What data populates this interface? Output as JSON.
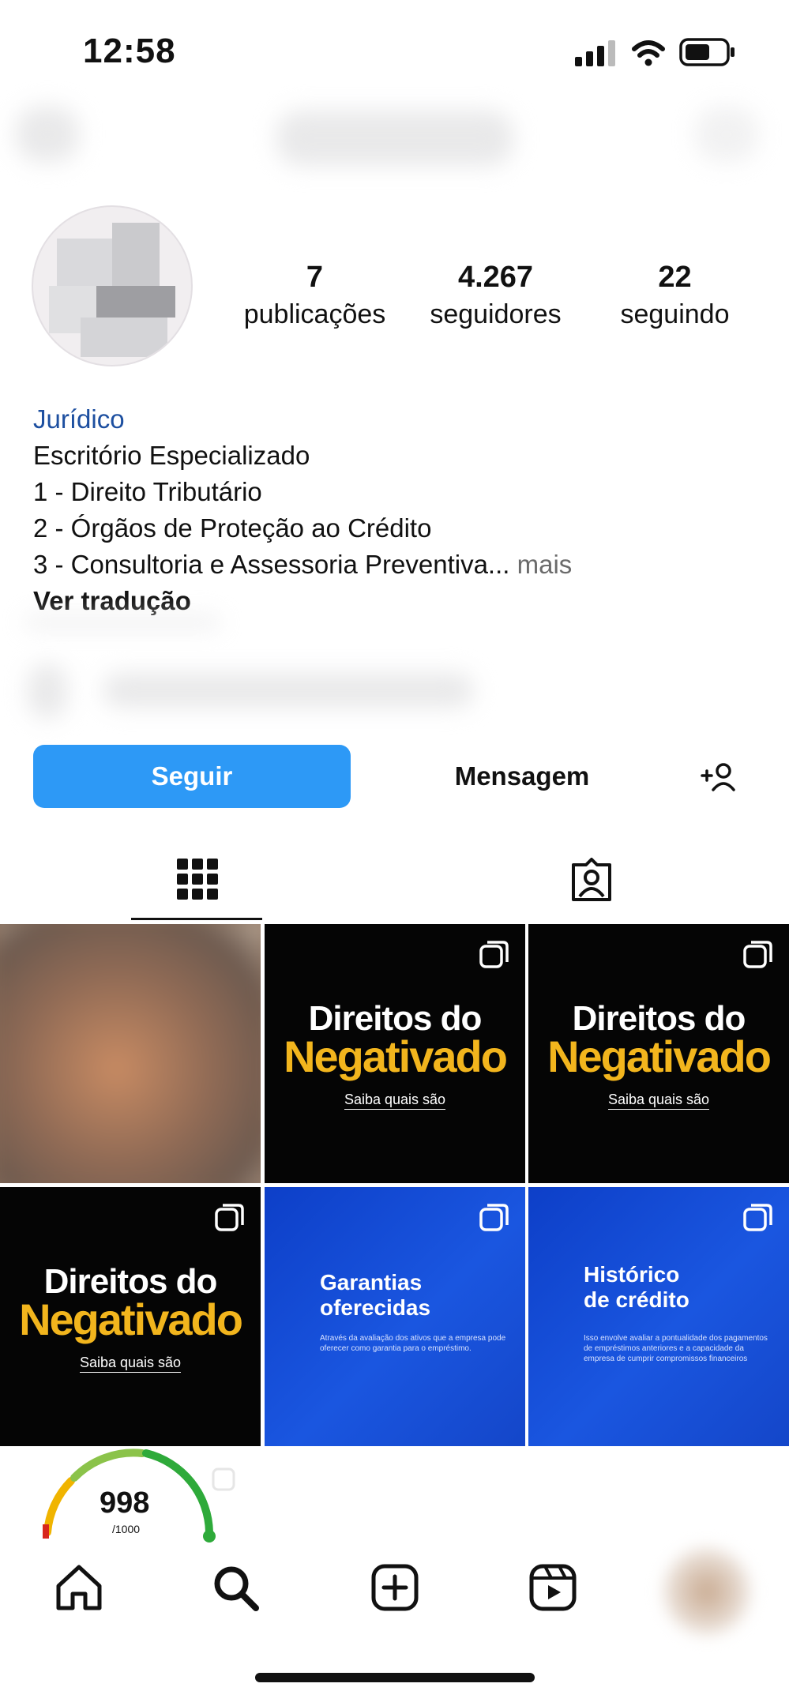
{
  "status_bar": {
    "time": "12:58"
  },
  "profile": {
    "stats": [
      {
        "value": "7",
        "label": "publicações"
      },
      {
        "value": "4.267",
        "label": "seguidores"
      },
      {
        "value": "22",
        "label": "seguindo"
      }
    ],
    "bio": {
      "name": "Jurídico",
      "lines": [
        "Escritório Especializado",
        "1 - Direito Tributário",
        "2 - Órgãos de Proteção ao Crédito",
        "3 - Consultoria e Assessoria Preventiva..."
      ],
      "more": " mais",
      "translate": "Ver tradução"
    },
    "actions": {
      "follow": "Seguir",
      "message": "Mensagem"
    }
  },
  "tabs": [
    {
      "icon": "grid-icon"
    },
    {
      "icon": "tagged-icon"
    }
  ],
  "posts": [
    {
      "style": "photo"
    },
    {
      "style": "black",
      "title": "Direitos do",
      "highlight": "Negativado",
      "subtitle": "Saiba quais são"
    },
    {
      "style": "black",
      "title": "Direitos do",
      "highlight": "Negativado",
      "subtitle": "Saiba quais são"
    },
    {
      "style": "black",
      "title": "Direitos do",
      "highlight": "Negativado",
      "subtitle": "Saiba quais são"
    },
    {
      "style": "blue",
      "title_line1": "Garantias",
      "title_line2": "oferecidas",
      "body": "Através da avaliação dos ativos que a empresa pode oferecer como garantia para o empréstimo."
    },
    {
      "style": "blue",
      "title_line1": "Histórico",
      "title_line2": "de crédito",
      "body": "Isso envolve avaliar a pontualidade dos pagamentos de empréstimos anteriores e a capacidade da empresa de cumprir compromissos financeiros"
    }
  ],
  "score_widget": {
    "value": "998",
    "max": "/1000"
  },
  "bottom_nav": [
    {
      "icon": "home-icon"
    },
    {
      "icon": "search-icon"
    },
    {
      "icon": "create-icon"
    },
    {
      "icon": "reels-icon"
    },
    {
      "icon": "profile-avatar"
    }
  ],
  "colors": {
    "follow_button": "#2d99f6",
    "highlight_yellow": "#f2b51d",
    "post_blue": "#1a56e0",
    "link_blue": "#1d4fa0"
  }
}
